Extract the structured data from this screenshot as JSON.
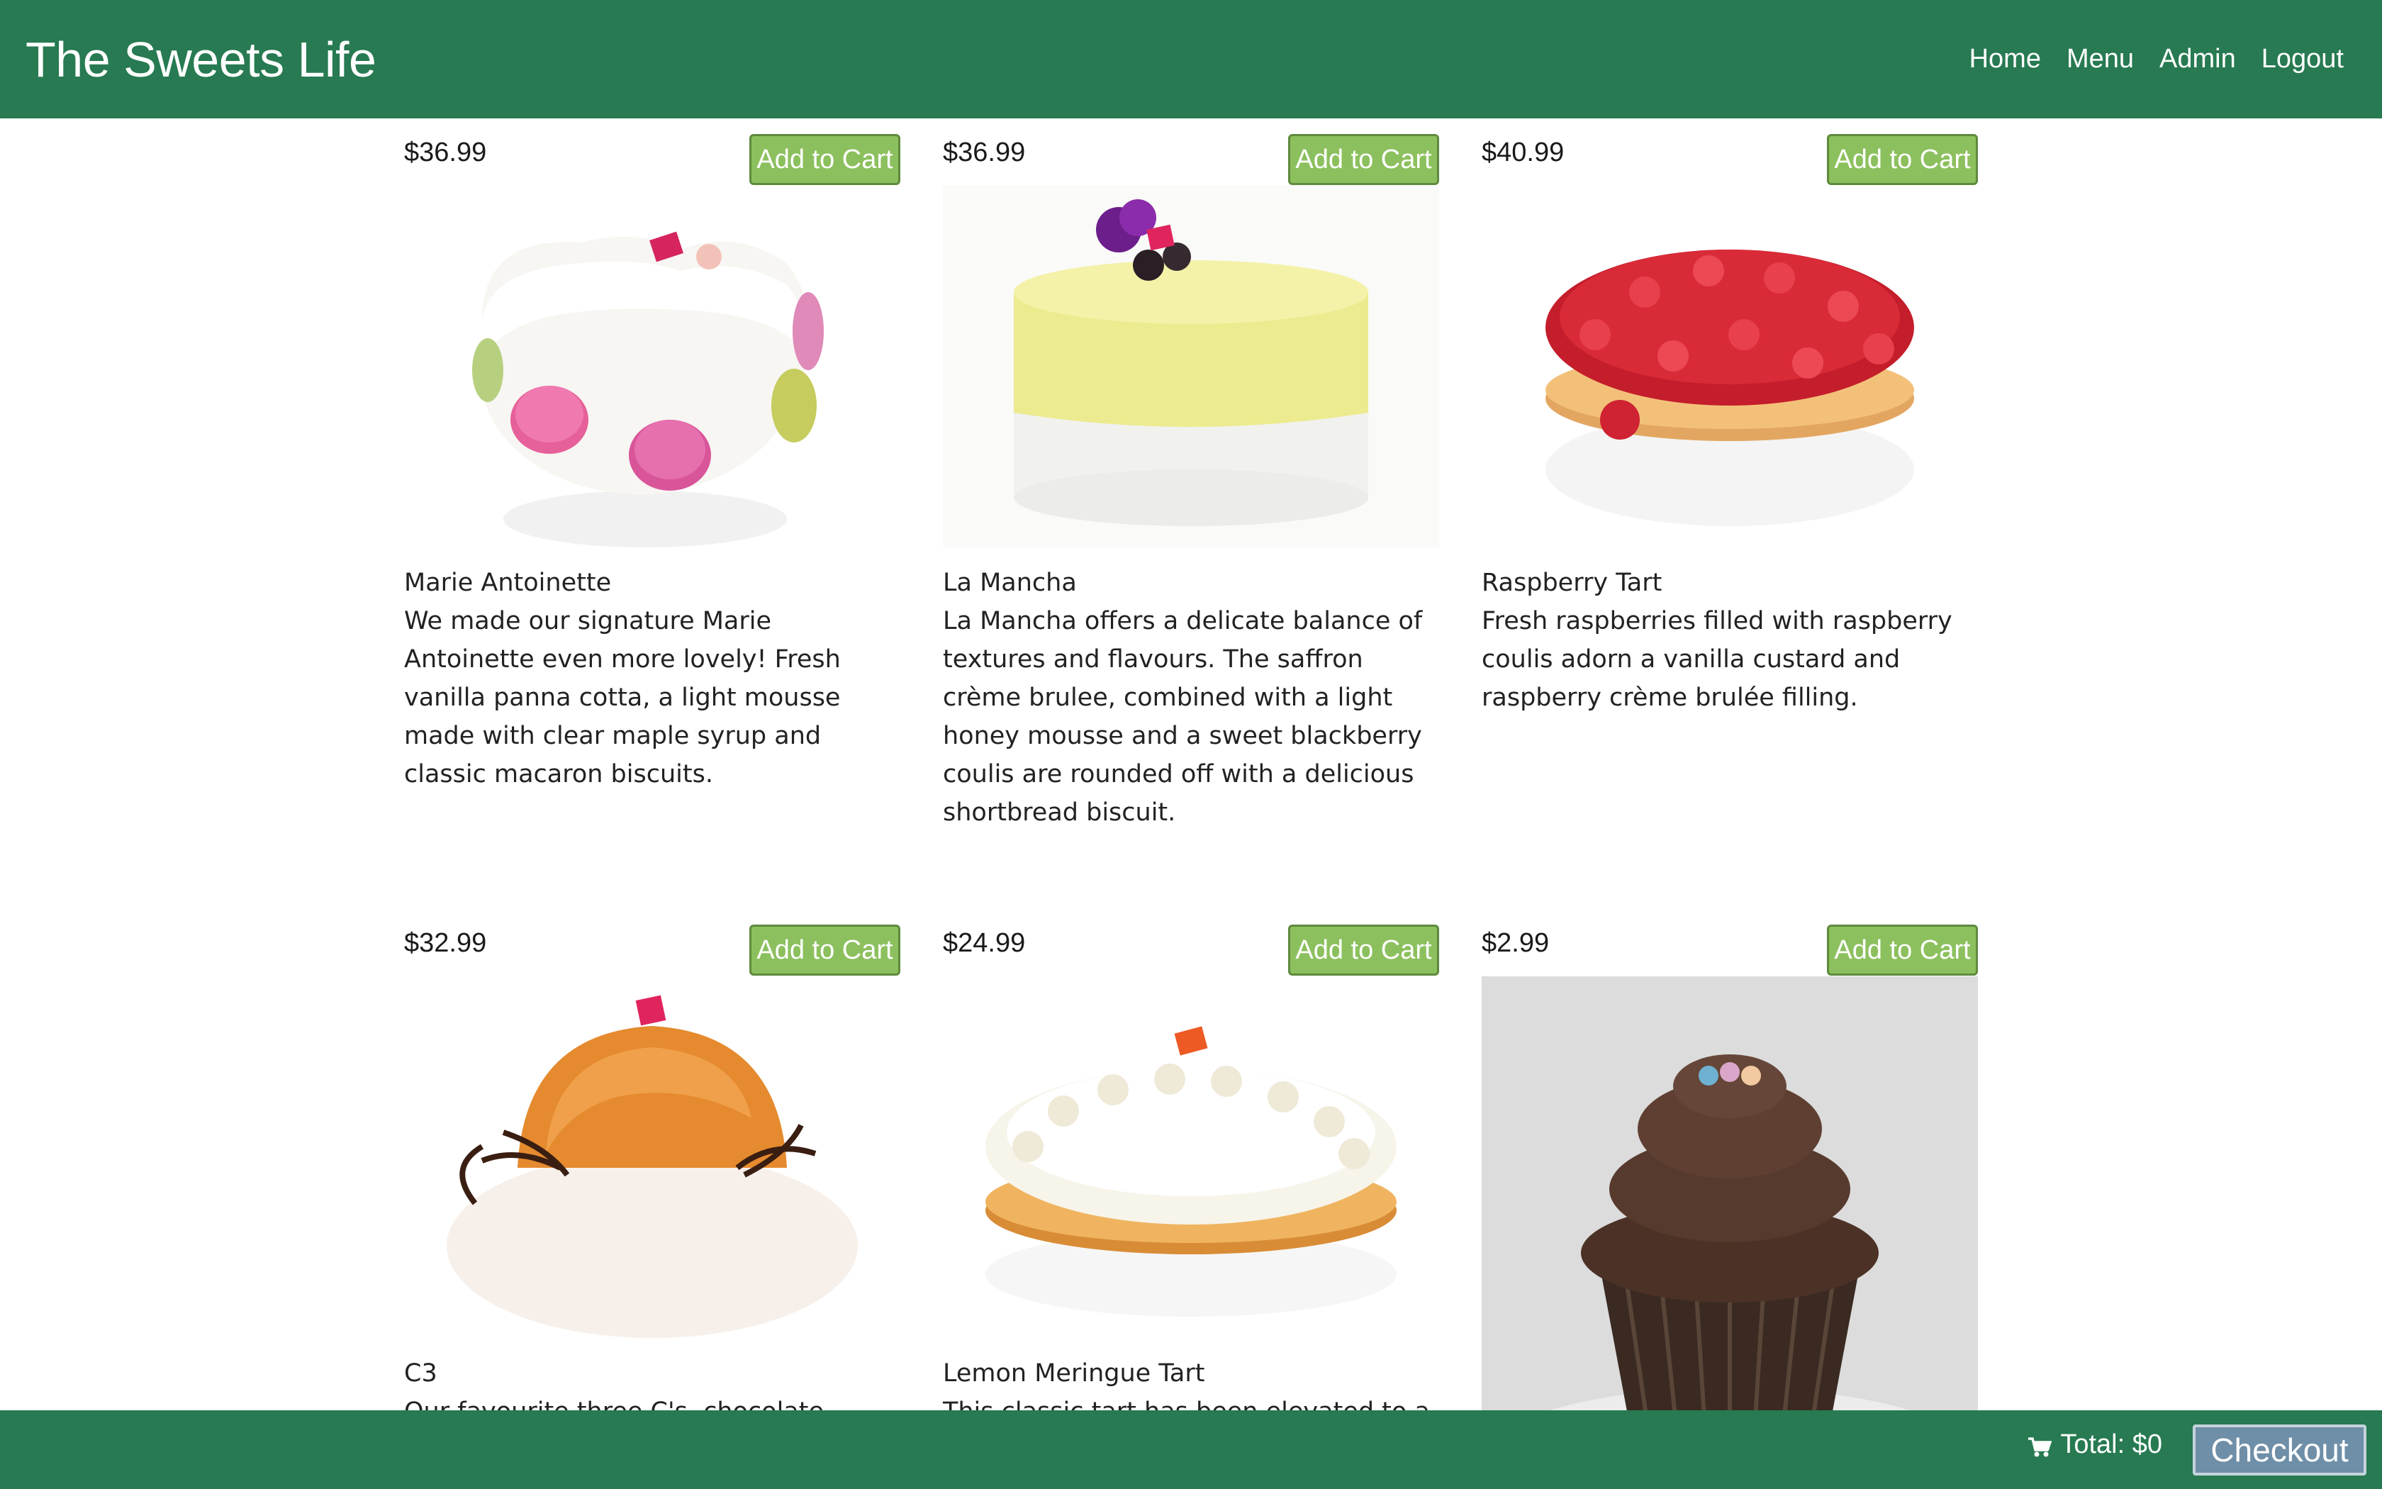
{
  "navbar": {
    "brand": "The Sweets Life",
    "links": [
      "Home",
      "Menu",
      "Admin",
      "Logout"
    ]
  },
  "products": [
    {
      "price": "$36.99",
      "button": "Add to Cart",
      "name": "Marie Antoinette",
      "description": "We made our signature Marie Antoinette even more lovely! Fresh vanilla panna cotta, a light mousse made with clear maple syrup and classic macaron biscuits."
    },
    {
      "price": "$36.99",
      "button": "Add to Cart",
      "name": "La Mancha",
      "description": "La Mancha offers a delicate balance of textures and flavours. The saffron crème brulee, combined with a light honey mousse and a sweet blackberry coulis are rounded off with a delicious shortbread biscuit."
    },
    {
      "price": "$40.99",
      "button": "Add to Cart",
      "name": "Raspberry Tart",
      "description": "Fresh raspberries filled with raspberry coulis adorn a vanilla custard and raspberry crème brulée filling."
    },
    {
      "price": "$32.99",
      "button": "Add to Cart",
      "name": "C3",
      "description": "Our favourite three C's, chocolate"
    },
    {
      "price": "$24.99",
      "button": "Add to Cart",
      "name": "Lemon Meringue Tart",
      "description": "This classic tart has been elevated to a"
    },
    {
      "price": "$2.99",
      "button": "Add to Cart",
      "name": "",
      "description": ""
    }
  ],
  "footer": {
    "cart_icon": "shopping-cart-icon",
    "total_label": "Total: $0",
    "checkout_label": "Checkout"
  },
  "colors": {
    "navbar": "#277a51",
    "add_button": "#8cc05e",
    "checkout_button": "#6f8fa8"
  }
}
